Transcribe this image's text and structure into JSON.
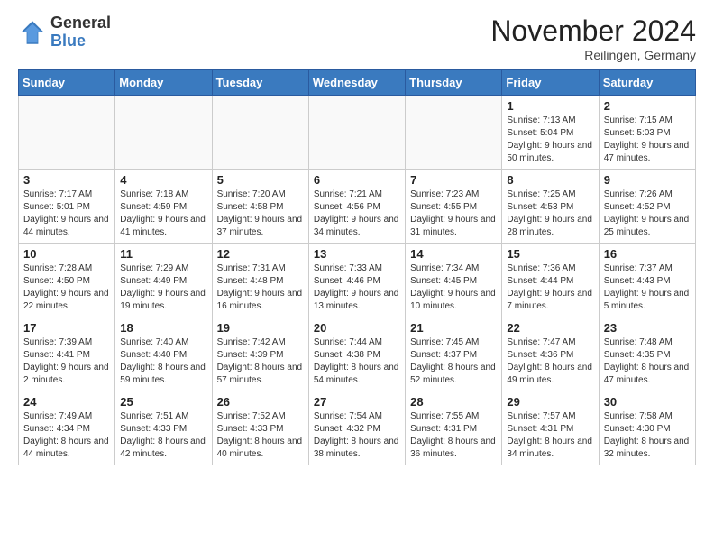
{
  "logo": {
    "general": "General",
    "blue": "Blue"
  },
  "header": {
    "title": "November 2024",
    "subtitle": "Reilingen, Germany"
  },
  "weekdays": [
    "Sunday",
    "Monday",
    "Tuesday",
    "Wednesday",
    "Thursday",
    "Friday",
    "Saturday"
  ],
  "weeks": [
    [
      {
        "day": "",
        "info": ""
      },
      {
        "day": "",
        "info": ""
      },
      {
        "day": "",
        "info": ""
      },
      {
        "day": "",
        "info": ""
      },
      {
        "day": "",
        "info": ""
      },
      {
        "day": "1",
        "info": "Sunrise: 7:13 AM\nSunset: 5:04 PM\nDaylight: 9 hours\nand 50 minutes."
      },
      {
        "day": "2",
        "info": "Sunrise: 7:15 AM\nSunset: 5:03 PM\nDaylight: 9 hours\nand 47 minutes."
      }
    ],
    [
      {
        "day": "3",
        "info": "Sunrise: 7:17 AM\nSunset: 5:01 PM\nDaylight: 9 hours\nand 44 minutes."
      },
      {
        "day": "4",
        "info": "Sunrise: 7:18 AM\nSunset: 4:59 PM\nDaylight: 9 hours\nand 41 minutes."
      },
      {
        "day": "5",
        "info": "Sunrise: 7:20 AM\nSunset: 4:58 PM\nDaylight: 9 hours\nand 37 minutes."
      },
      {
        "day": "6",
        "info": "Sunrise: 7:21 AM\nSunset: 4:56 PM\nDaylight: 9 hours\nand 34 minutes."
      },
      {
        "day": "7",
        "info": "Sunrise: 7:23 AM\nSunset: 4:55 PM\nDaylight: 9 hours\nand 31 minutes."
      },
      {
        "day": "8",
        "info": "Sunrise: 7:25 AM\nSunset: 4:53 PM\nDaylight: 9 hours\nand 28 minutes."
      },
      {
        "day": "9",
        "info": "Sunrise: 7:26 AM\nSunset: 4:52 PM\nDaylight: 9 hours\nand 25 minutes."
      }
    ],
    [
      {
        "day": "10",
        "info": "Sunrise: 7:28 AM\nSunset: 4:50 PM\nDaylight: 9 hours\nand 22 minutes."
      },
      {
        "day": "11",
        "info": "Sunrise: 7:29 AM\nSunset: 4:49 PM\nDaylight: 9 hours\nand 19 minutes."
      },
      {
        "day": "12",
        "info": "Sunrise: 7:31 AM\nSunset: 4:48 PM\nDaylight: 9 hours\nand 16 minutes."
      },
      {
        "day": "13",
        "info": "Sunrise: 7:33 AM\nSunset: 4:46 PM\nDaylight: 9 hours\nand 13 minutes."
      },
      {
        "day": "14",
        "info": "Sunrise: 7:34 AM\nSunset: 4:45 PM\nDaylight: 9 hours\nand 10 minutes."
      },
      {
        "day": "15",
        "info": "Sunrise: 7:36 AM\nSunset: 4:44 PM\nDaylight: 9 hours\nand 7 minutes."
      },
      {
        "day": "16",
        "info": "Sunrise: 7:37 AM\nSunset: 4:43 PM\nDaylight: 9 hours\nand 5 minutes."
      }
    ],
    [
      {
        "day": "17",
        "info": "Sunrise: 7:39 AM\nSunset: 4:41 PM\nDaylight: 9 hours\nand 2 minutes."
      },
      {
        "day": "18",
        "info": "Sunrise: 7:40 AM\nSunset: 4:40 PM\nDaylight: 8 hours\nand 59 minutes."
      },
      {
        "day": "19",
        "info": "Sunrise: 7:42 AM\nSunset: 4:39 PM\nDaylight: 8 hours\nand 57 minutes."
      },
      {
        "day": "20",
        "info": "Sunrise: 7:44 AM\nSunset: 4:38 PM\nDaylight: 8 hours\nand 54 minutes."
      },
      {
        "day": "21",
        "info": "Sunrise: 7:45 AM\nSunset: 4:37 PM\nDaylight: 8 hours\nand 52 minutes."
      },
      {
        "day": "22",
        "info": "Sunrise: 7:47 AM\nSunset: 4:36 PM\nDaylight: 8 hours\nand 49 minutes."
      },
      {
        "day": "23",
        "info": "Sunrise: 7:48 AM\nSunset: 4:35 PM\nDaylight: 8 hours\nand 47 minutes."
      }
    ],
    [
      {
        "day": "24",
        "info": "Sunrise: 7:49 AM\nSunset: 4:34 PM\nDaylight: 8 hours\nand 44 minutes."
      },
      {
        "day": "25",
        "info": "Sunrise: 7:51 AM\nSunset: 4:33 PM\nDaylight: 8 hours\nand 42 minutes."
      },
      {
        "day": "26",
        "info": "Sunrise: 7:52 AM\nSunset: 4:33 PM\nDaylight: 8 hours\nand 40 minutes."
      },
      {
        "day": "27",
        "info": "Sunrise: 7:54 AM\nSunset: 4:32 PM\nDaylight: 8 hours\nand 38 minutes."
      },
      {
        "day": "28",
        "info": "Sunrise: 7:55 AM\nSunset: 4:31 PM\nDaylight: 8 hours\nand 36 minutes."
      },
      {
        "day": "29",
        "info": "Sunrise: 7:57 AM\nSunset: 4:31 PM\nDaylight: 8 hours\nand 34 minutes."
      },
      {
        "day": "30",
        "info": "Sunrise: 7:58 AM\nSunset: 4:30 PM\nDaylight: 8 hours\nand 32 minutes."
      }
    ]
  ]
}
